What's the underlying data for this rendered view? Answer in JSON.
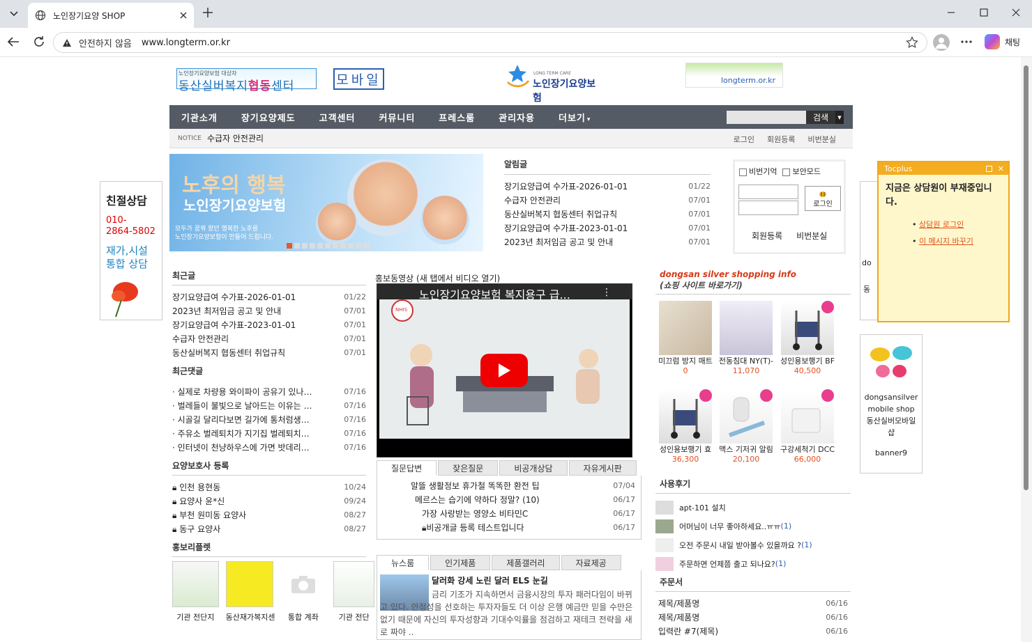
{
  "browser": {
    "tab_title": "노인장기요양 SHOP",
    "security_label": "안전하지 않음",
    "url": "www.longterm.or.kr",
    "copilot_label": "채팅"
  },
  "header": {
    "logo_small": "노인장기요양보험 대상자",
    "logo_main_a": "동산실버복지",
    "logo_main_b": "협동",
    "logo_main_c": "센터",
    "mobile_label": "모바일",
    "brand_sub": "LONG TERM CARE",
    "brand_name": "노인장기요양보험",
    "lt_banner": "longterm.or.kr"
  },
  "gnb": {
    "items": [
      "기관소개",
      "장기요양제도",
      "고객센터",
      "커뮤니티",
      "프레스룸",
      "관리자용",
      "더보기"
    ],
    "more_arrow": "▾",
    "search_btn": "검색",
    "search_drop": "▼"
  },
  "notice_bar": {
    "label": "NOTICE",
    "text": "수급자 안전관리",
    "links": [
      "로그인",
      "회원등록",
      "비번분실"
    ]
  },
  "left_banner": {
    "title": "친절상담",
    "phone1": "010-",
    "phone2": "2864-5802",
    "sub1": "재가,시설",
    "sub2": "통합 상담"
  },
  "hero": {
    "line1": "노후의 행복",
    "line2": "노인장기요양보험",
    "line3": "모두가 꿈꿔 왔던 행복한 노후를",
    "line4": "노인장기요양보험이 만들어 드립니다."
  },
  "notice_list": {
    "title": "알림글",
    "items": [
      {
        "t": "장기요양급여 수가표-2026-01-01",
        "d": "01/22"
      },
      {
        "t": "수급자 안전관리",
        "d": "07/01"
      },
      {
        "t": "동산실버복지 협동센터 취업규칙",
        "d": "07/01"
      },
      {
        "t": "장기요양급여 수가표-2023-01-01",
        "d": "07/01"
      },
      {
        "t": "2023년 최저임금 공고 및 안내",
        "d": "07/01"
      }
    ]
  },
  "login": {
    "remember_id": "비번기억",
    "secure_mode": "보안모드",
    "login_btn": "로그인",
    "signup": "회원등록",
    "find_pw": "비번분실"
  },
  "recent_posts": {
    "title": "최근글",
    "items": [
      {
        "t": "장기요양급여 수가표-2026-01-01",
        "d": "01/22"
      },
      {
        "t": "2023년 최저임금 공고 및 안내",
        "d": "07/01"
      },
      {
        "t": "장기요양급여 수가표-2023-01-01",
        "d": "07/01"
      },
      {
        "t": "수급자 안전관리",
        "d": "07/01"
      },
      {
        "t": "동산실버복지 협동센터 취업규칙",
        "d": "07/01"
      }
    ]
  },
  "recent_comments": {
    "title": "최근댓글",
    "items": [
      {
        "t": "· 실제로 차량용 와이파이 공유기 있나…",
        "d": "07/16"
      },
      {
        "t": "· 벌레들이 불빛으로 날아드는 이유는 …",
        "d": "07/16"
      },
      {
        "t": "· 시골길 달리다보면 길가에 통처럼생…",
        "d": "07/16"
      },
      {
        "t": "· 주유소 벌레퇴치가 지기집 벌레퇴치…",
        "d": "07/16"
      },
      {
        "t": "· 인터넷이 천냥하우스에 가면 밧데리…",
        "d": "07/16"
      }
    ]
  },
  "caregiver": {
    "title": "요양보호사 등록",
    "items": [
      {
        "t": "인천 용현동",
        "d": "10/24"
      },
      {
        "t": "요양사 윤*신",
        "d": "09/24"
      },
      {
        "t": "부천 원미동 요양사",
        "d": "08/27"
      },
      {
        "t": "동구 요양사",
        "d": "08/27"
      }
    ]
  },
  "leaflet": {
    "title": "홍보리플렛",
    "items": [
      "기관 전단지",
      "동산재가복지센",
      "통합 계좌",
      "기관 전단"
    ]
  },
  "video": {
    "heading": "홍보동영상 (새 탭에서 비디오 열기)",
    "title": "노인장기요양보험 복지용구 급...",
    "badge": "NHIS"
  },
  "qa": {
    "tabs": [
      "질문답변",
      "잦은질문",
      "비공개상담",
      "자유게시판"
    ],
    "items": [
      {
        "t": "알뜰 생활정보 휴가철 똑똑한 환전 팁",
        "d": "07/04"
      },
      {
        "t": "메르스는 습기에 약하다 정말? (10)",
        "d": "06/17"
      },
      {
        "t": "가장 사랑받는 영양소 비타민C",
        "d": "06/17"
      },
      {
        "t": "비공개글 등록 테스트입니다",
        "d": "06/17"
      }
    ]
  },
  "news": {
    "tabs": [
      "뉴스룸",
      "인기제품",
      "제품갤러리",
      "자료제공"
    ],
    "headline": "달러화 강세 노린 달러 ELS 눈길",
    "body": "금리 기조가 지속하면서 금융시장의 투자 패러다임이 바뀌고 있다. 안정성을 선호하는 투자자들도 더 이상 은행 예금만 믿을 수만은 없기 때문에 자신의 투자성향과 기대수익률을 점검하고 재테크 전략을 새로 짜야 .."
  },
  "shop": {
    "title": "dongsan silver shopping info",
    "subtitle": "(쇼핑 사이트 바로가기)",
    "products": [
      {
        "name": "미끄럼 방지 매트",
        "price": "0"
      },
      {
        "name": "전동침대 NY(T)-",
        "price": "11,070"
      },
      {
        "name": "성인용보행기 BF",
        "price": "40,500"
      },
      {
        "name": "성인용보행기 효",
        "price": "36,300"
      },
      {
        "name": "맥스 기저귀 알림",
        "price": "20,100"
      },
      {
        "name": "구강세척기 DCC",
        "price": "66,000"
      }
    ]
  },
  "reviews": {
    "title": "사용후기",
    "items": [
      {
        "t": "apt-101 설치",
        "c": ""
      },
      {
        "t": "어머님이 너무 좋아하세요..ㅠㅠ",
        "c": "(1)"
      },
      {
        "t": "오전 주문시 내일 받아볼수 있을까요 ?",
        "c": "(1)"
      },
      {
        "t": "주문하면 언제쯤 출고 되나요?",
        "c": "(1)"
      }
    ]
  },
  "orders": {
    "title": "주문서",
    "items": [
      {
        "t": "제목/제품명",
        "d": "06/16"
      },
      {
        "t": "제목/제품명",
        "d": "06/16"
      },
      {
        "t": "입력란 #7(제목)",
        "d": "06/16"
      }
    ]
  },
  "talk": {
    "brand": "Tocplus",
    "message": "지금은 상담원이 부재중입니다.",
    "links": [
      "상담원 로그인",
      "이 메시지 바꾸기"
    ]
  },
  "side_banner": {
    "peek1": "do",
    "peek2": "동",
    "line1": "dongsansilver",
    "line2": "mobile shop",
    "line3": "동산실버모바일샵",
    "label": "banner9"
  }
}
